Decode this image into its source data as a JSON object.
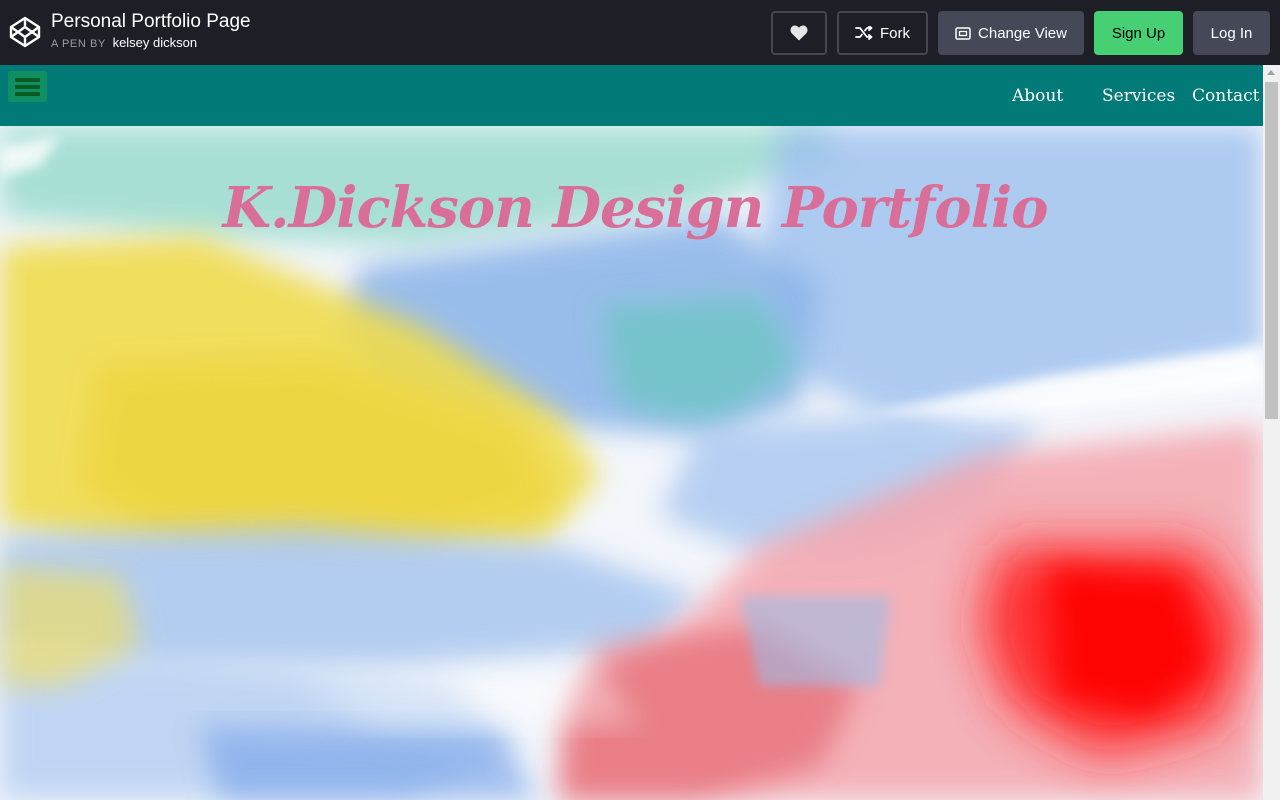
{
  "codepen": {
    "title": "Personal Portfolio Page",
    "byline_prefix": "A PEN BY",
    "author": "kelsey dickson",
    "buttons": {
      "heart_icon": "heart-icon",
      "fork_label": "Fork",
      "fork_icon": "fork-icon",
      "change_view_label": "Change View",
      "change_view_icon": "layout-icon",
      "signup_label": "Sign Up",
      "login_label": "Log In"
    },
    "colors": {
      "header_bg": "#1e1f26",
      "signup_bg": "#47cf73",
      "button_gray": "#444857"
    }
  },
  "site": {
    "nav": {
      "menu_icon": "hamburger-menu-icon",
      "links": [
        "About",
        "Services",
        "Contact"
      ],
      "background": "#027a77"
    },
    "hero": {
      "title": "K.Dickson Design Portfolio",
      "title_color": "#d96f98"
    }
  }
}
